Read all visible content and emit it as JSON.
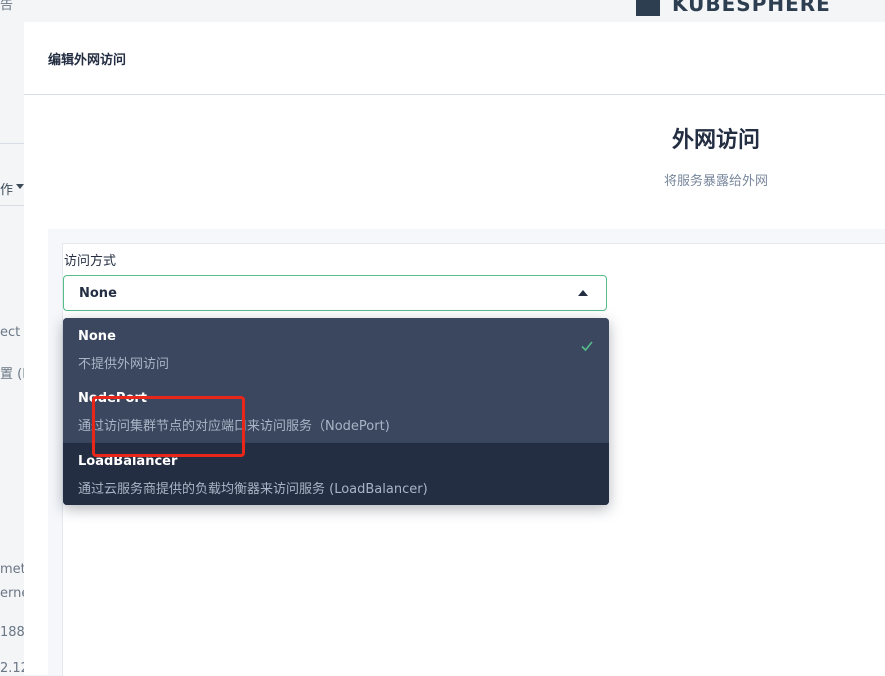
{
  "background": {
    "logo_text": "KUBESPHERE",
    "fragments": {
      "top": "告",
      "dropdown_label": "作",
      "project": "ect",
      "host": "置 (H",
      "meter": "mete",
      "kernel": "erne",
      "ip1": "188",
      "ip2": "2.12"
    }
  },
  "modal": {
    "title": "编辑外网访问",
    "hero_title": "外网访问",
    "hero_subtitle": "将服务暴露给外网"
  },
  "form": {
    "field_label": "访问方式",
    "selected_value": "None",
    "options": [
      {
        "name": "None",
        "description": "不提供外网访问",
        "selected": true
      },
      {
        "name": "NodePort",
        "description": "通过访问集群节点的对应端口来访问服务（NodePort)",
        "selected": false
      },
      {
        "name": "LoadBalancer",
        "description": "通过云服务商提供的负载均衡器来访问服务 (LoadBalancer)",
        "selected": false
      }
    ]
  },
  "colors": {
    "accent_green": "#55bc8a",
    "dropdown_bg": "#36435c",
    "annotation_red": "#e8271a"
  },
  "icons": [
    "caret-up-icon",
    "check-icon",
    "logo-icon",
    "chevron-down-icon"
  ]
}
